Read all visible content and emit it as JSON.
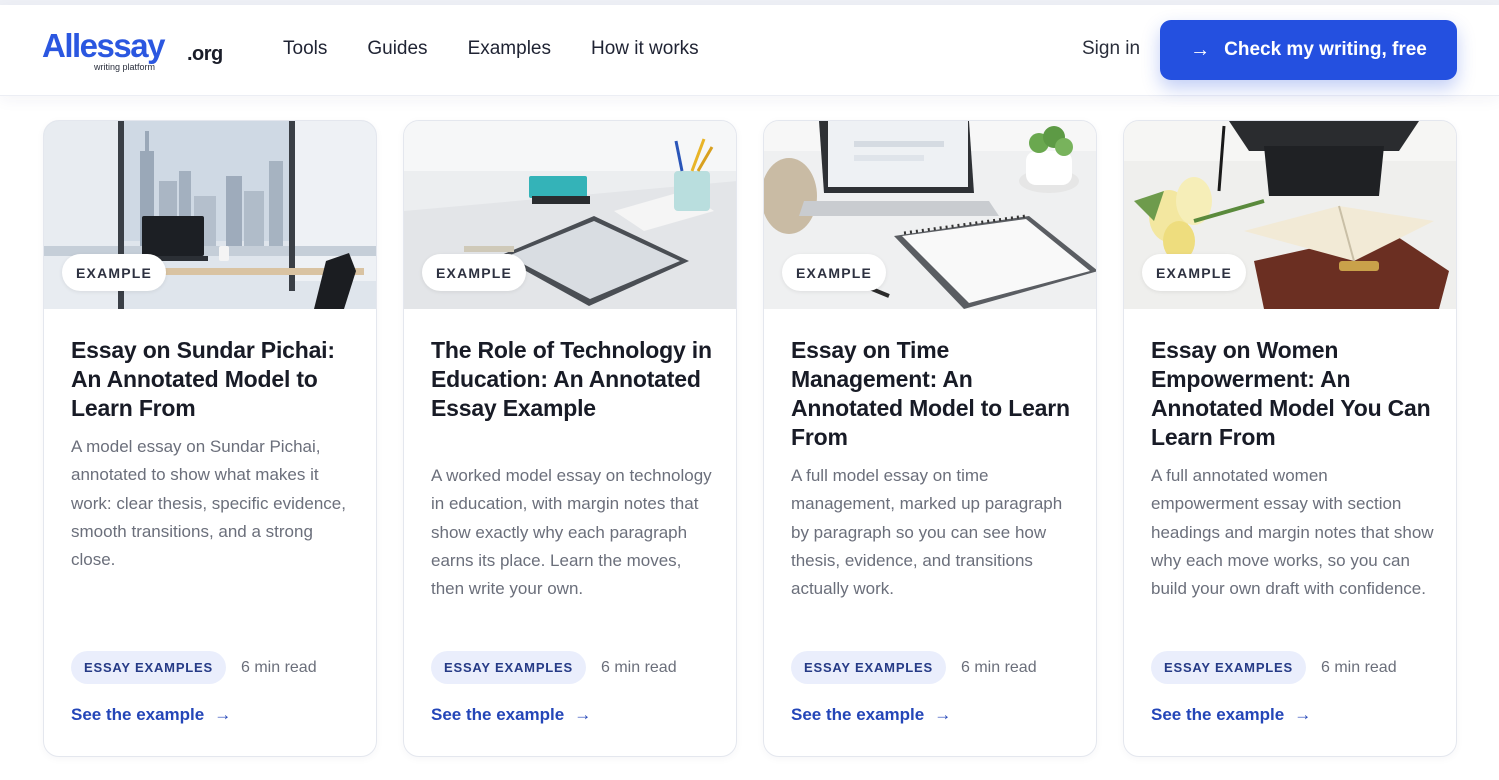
{
  "header": {
    "logo_main": "Allessay",
    "logo_tld": ".org",
    "logo_tagline": "writing platform",
    "nav": [
      "Tools",
      "Guides",
      "Examples",
      "How it works"
    ],
    "sign_in": "Sign in",
    "cta_label": "Check my writing, free",
    "cta_icon": "arrow-right-icon"
  },
  "cards": [
    {
      "badge": "EXAMPLE",
      "title": "Essay on Sundar Pichai: An Annotated Model to Learn From",
      "description": "A model essay on Sundar Pichai, annotated to show what makes it work: clear thesis, specific evidence, smooth transitions, and a strong close.",
      "tag": "ESSAY EXAMPLES",
      "read_time": "6 min read",
      "link": "See the example"
    },
    {
      "badge": "EXAMPLE",
      "title": "The Role of Technology in Education: An Annotated Essay Example",
      "description": "A worked model essay on technology in education, with margin notes that show exactly why each paragraph earns its place. Learn the moves, then write your own.",
      "tag": "ESSAY EXAMPLES",
      "read_time": "6 min read",
      "link": "See the example"
    },
    {
      "badge": "EXAMPLE",
      "title": "Essay on Time Management: An Annotated Model to Learn From",
      "description": "A full model essay on time management, marked up paragraph by paragraph so you can see how thesis, evidence, and transitions actually work.",
      "tag": "ESSAY EXAMPLES",
      "read_time": "6 min read",
      "link": "See the example"
    },
    {
      "badge": "EXAMPLE",
      "title": "Essay on Women Empowerment: An Annotated Model You Can Learn From",
      "description": "A full annotated women empowerment essay with section headings and margin notes that show why each move works, so you can build your own draft with confidence.",
      "tag": "ESSAY EXAMPLES",
      "read_time": "6 min read",
      "link": "See the example"
    }
  ],
  "colors": {
    "brand_blue": "#2450e0",
    "logo_yellow": "#f7b32b",
    "link_blue": "#2446b8",
    "tag_bg": "#eaeefc"
  }
}
